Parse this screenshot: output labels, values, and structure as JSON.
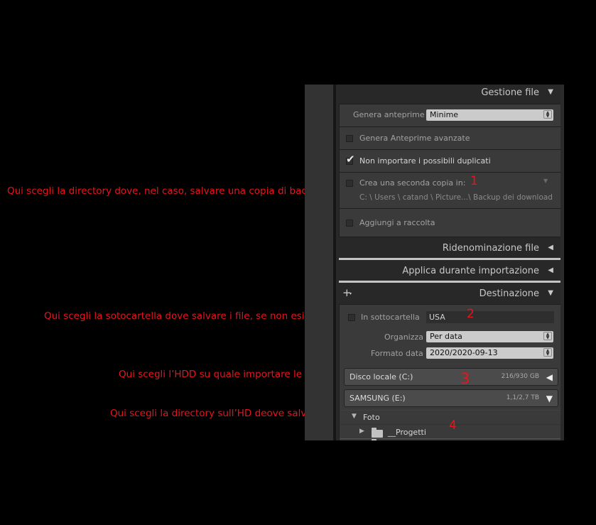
{
  "annotations": [
    "Qui scegli la directory dove, nel caso, salvare una copia di backup",
    "Qui scegli la sotocartella dove salvare i file, se non esiste",
    "Qui scegli l’HDD su quale importare le foto",
    "Qui scegli la directory sull’HD deove salvarle"
  ],
  "markers": [
    "1",
    "2",
    "3",
    "4"
  ],
  "gestione_file": {
    "header": "Gestione file",
    "genera_anteprime_label": "Genera anteprime",
    "genera_anteprime_value": "Minime",
    "anteprime_avanzate": {
      "label": "Genera Anteprime avanzate",
      "checked": false
    },
    "non_importare_duplicati": {
      "label": "Non importare i possibili duplicati",
      "checked": true
    },
    "seconda_copia": {
      "label": "Crea una seconda copia in:",
      "checked": false,
      "path": "C: \\ Users \\ catand \\ Picture...\\ Backup dei download"
    },
    "aggiungi_raccolta": {
      "label": "Aggiungi a raccolta",
      "checked": false
    }
  },
  "ridenominazione": {
    "header": "Ridenominazione file"
  },
  "applica": {
    "header": "Applica durante importazione"
  },
  "destinazione": {
    "header": "Destinazione",
    "in_sottocartella": {
      "label": "In sottocartella",
      "checked": false,
      "value": "USA"
    },
    "organizza": {
      "label": "Organizza",
      "value": "Per data"
    },
    "formato_data": {
      "label": "Formato data",
      "value": "2020/2020-09-13"
    },
    "drives": [
      {
        "name": "Disco locale (C:)",
        "size": "216/930 GB"
      },
      {
        "name": "SAMSUNG (E:)",
        "size": "1,1/2,7 TB"
      }
    ],
    "tree": [
      {
        "name": "Foto"
      },
      {
        "name": "__Progetti"
      }
    ]
  }
}
